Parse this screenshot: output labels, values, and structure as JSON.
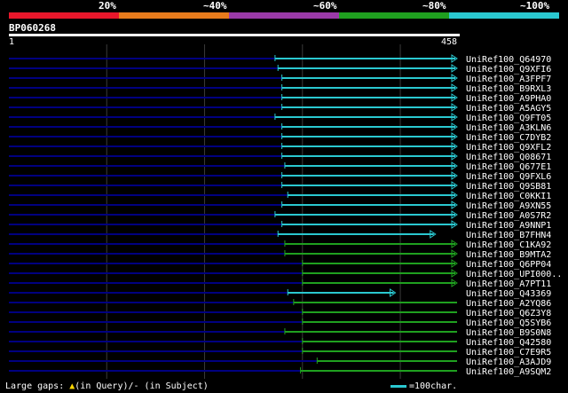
{
  "legend": {
    "labels": [
      "20%",
      "~40%",
      "~60%",
      "~80%",
      "~100%"
    ],
    "colors": [
      "#e8172b",
      "#e87b1c",
      "#9a3aa8",
      "#1fa01f",
      "#2ac8d0"
    ]
  },
  "query": {
    "name": "BP060268",
    "start": "1",
    "end": "458",
    "length": 458
  },
  "colors": {
    "cyan": "#2ac8d0",
    "green": "#1fa01f",
    "navy": "#000080",
    "grid": "#3a3a3a"
  },
  "hits": [
    {
      "label": "UniRef100_Q64970",
      "start": 272,
      "end": 458,
      "color": "cyan",
      "arrow": true
    },
    {
      "label": "UniRef100_Q9XFI6",
      "start": 275,
      "end": 458,
      "color": "cyan",
      "arrow": true
    },
    {
      "label": "UniRef100_A3FPF7",
      "start": 279,
      "end": 458,
      "color": "cyan",
      "arrow": true
    },
    {
      "label": "UniRef100_B9RXL3",
      "start": 279,
      "end": 458,
      "color": "cyan",
      "arrow": true
    },
    {
      "label": "UniRef100_A9PHA0",
      "start": 279,
      "end": 458,
      "color": "cyan",
      "arrow": true
    },
    {
      "label": "UniRef100_A5AGY5",
      "start": 279,
      "end": 458,
      "color": "cyan",
      "arrow": true
    },
    {
      "label": "UniRef100_Q9FT05",
      "start": 272,
      "end": 458,
      "color": "cyan",
      "arrow": true
    },
    {
      "label": "UniRef100_A3KLN6",
      "start": 279,
      "end": 458,
      "color": "cyan",
      "arrow": true
    },
    {
      "label": "UniRef100_C7DYB2",
      "start": 279,
      "end": 458,
      "color": "cyan",
      "arrow": true
    },
    {
      "label": "UniRef100_Q9XFL2",
      "start": 279,
      "end": 458,
      "color": "cyan",
      "arrow": true
    },
    {
      "label": "UniRef100_Q08671",
      "start": 279,
      "end": 458,
      "color": "cyan",
      "arrow": true
    },
    {
      "label": "UniRef100_Q677E1",
      "start": 282,
      "end": 458,
      "color": "cyan",
      "arrow": true
    },
    {
      "label": "UniRef100_Q9FXL6",
      "start": 279,
      "end": 458,
      "color": "cyan",
      "arrow": true
    },
    {
      "label": "UniRef100_Q9SB81",
      "start": 279,
      "end": 458,
      "color": "cyan",
      "arrow": true
    },
    {
      "label": "UniRef100_C0KKI1",
      "start": 285,
      "end": 458,
      "color": "cyan",
      "arrow": true
    },
    {
      "label": "UniRef100_A9XN55",
      "start": 279,
      "end": 458,
      "color": "cyan",
      "arrow": true
    },
    {
      "label": "UniRef100_A0S7R2",
      "start": 272,
      "end": 458,
      "color": "cyan",
      "arrow": true
    },
    {
      "label": "UniRef100_A9NNP1",
      "start": 279,
      "end": 458,
      "color": "cyan",
      "arrow": true
    },
    {
      "label": "UniRef100_B7FHN4",
      "start": 275,
      "end": 436,
      "color": "cyan",
      "arrow": true
    },
    {
      "label": "UniRef100_C1KA92",
      "start": 282,
      "end": 458,
      "color": "green",
      "arrow": true
    },
    {
      "label": "UniRef100_B9MTA2",
      "start": 282,
      "end": 458,
      "color": "green",
      "arrow": true
    },
    {
      "label": "UniRef100_Q6PP04",
      "start": 300,
      "end": 458,
      "color": "green",
      "arrow": true
    },
    {
      "label": "UniRef100_UPI000..",
      "start": 300,
      "end": 458,
      "color": "green",
      "arrow": true
    },
    {
      "label": "UniRef100_A7PT11",
      "start": 300,
      "end": 458,
      "color": "green",
      "arrow": true
    },
    {
      "label": "UniRef100_Q43369",
      "start": 285,
      "end": 395,
      "color": "cyan",
      "arrow": true
    },
    {
      "label": "UniRef100_A2YQ86",
      "start": 291,
      "end": 458,
      "color": "green",
      "arrow": false
    },
    {
      "label": "UniRef100_Q6Z3Y8",
      "start": 300,
      "end": 458,
      "color": "green",
      "arrow": false
    },
    {
      "label": "UniRef100_Q5SYB6",
      "start": 300,
      "end": 458,
      "color": "green",
      "arrow": false
    },
    {
      "label": "UniRef100_B9S0N8",
      "start": 282,
      "end": 458,
      "color": "green",
      "arrow": false
    },
    {
      "label": "UniRef100_Q42580",
      "start": 300,
      "end": 458,
      "color": "green",
      "arrow": false
    },
    {
      "label": "UniRef100_C7E9R5",
      "start": 300,
      "end": 458,
      "color": "green",
      "arrow": false
    },
    {
      "label": "UniRef100_A3AJD9",
      "start": 315,
      "end": 458,
      "color": "green",
      "arrow": false
    },
    {
      "label": "UniRef100_A9SQM2",
      "start": 298,
      "end": 458,
      "color": "green",
      "arrow": false
    }
  ],
  "gridlines_at": [
    100,
    200,
    300,
    400
  ],
  "footer": {
    "left_prefix": "Large gaps: ",
    "left_query_mark": "▲",
    "left_rest": "(in Query)/- (in Subject)",
    "scale_label": "=100char."
  }
}
